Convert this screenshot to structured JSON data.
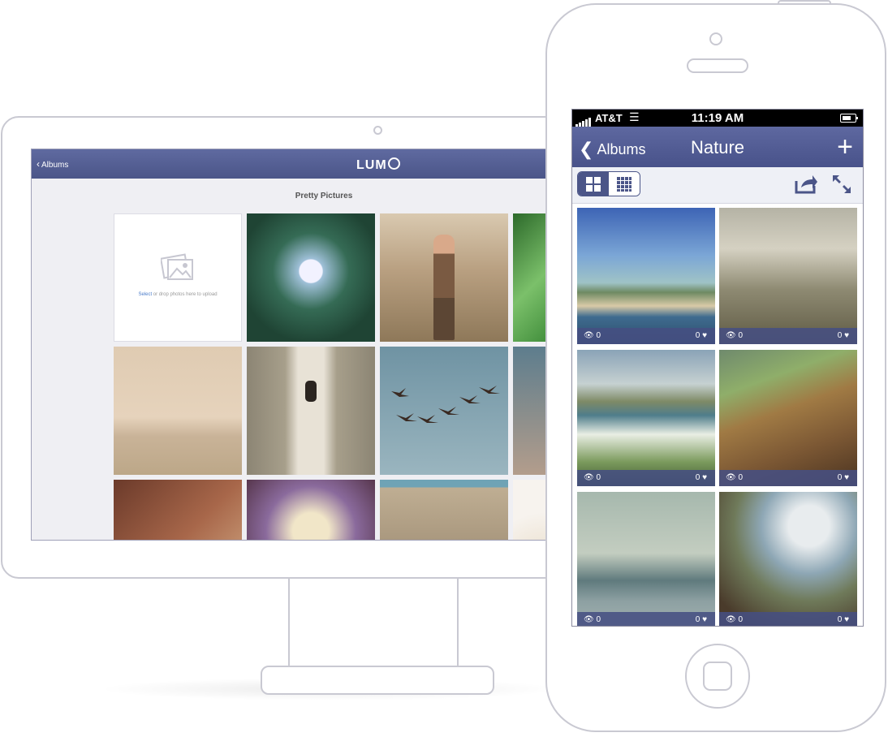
{
  "desktop": {
    "back_label": "Albums",
    "logo": "LUM",
    "album_title": "Pretty Pictures",
    "upload": {
      "select_link": "Select",
      "text": " or drop photos here to upload"
    }
  },
  "phone": {
    "status": {
      "carrier": "AT&T",
      "time": "11:19 AM"
    },
    "nav": {
      "back_label": "Albums",
      "title": "Nature",
      "add_label": "+"
    },
    "photos": [
      {
        "views": "0",
        "likes": "0"
      },
      {
        "views": "0",
        "likes": "0"
      },
      {
        "views": "0",
        "likes": "0"
      },
      {
        "views": "0",
        "likes": "0"
      },
      {
        "views": "0",
        "likes": "0"
      },
      {
        "views": "0",
        "likes": "0"
      }
    ]
  },
  "colors": {
    "accent": "#4b5588",
    "link": "#4a7cc9",
    "device_outline": "#c9c9d2"
  },
  "icons": [
    "chevron-left-icon",
    "image-upload-icon",
    "signal-icon",
    "wifi-icon",
    "battery-icon",
    "grid-large-icon",
    "grid-small-icon",
    "share-icon",
    "expand-icon",
    "eye-icon",
    "heart-icon"
  ]
}
